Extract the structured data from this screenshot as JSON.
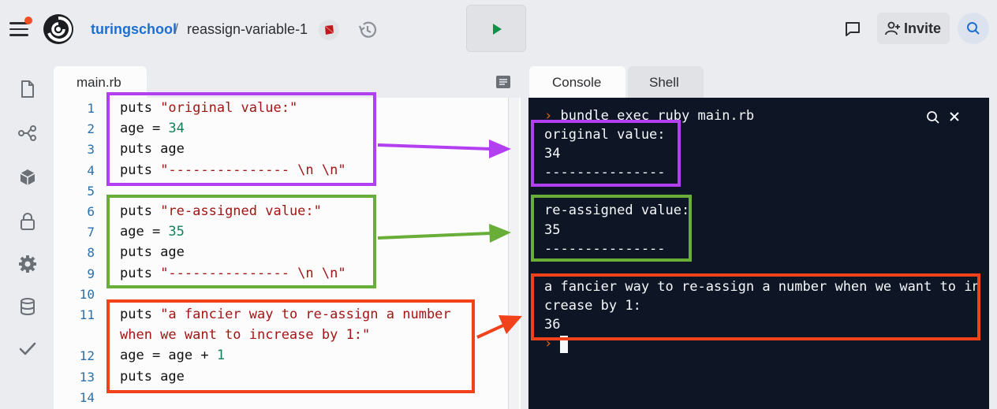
{
  "header": {
    "owner": "turingschool",
    "separator": "/",
    "repl_name": "reassign-variable-1",
    "invite_label": "Invite"
  },
  "editor": {
    "file_tab": "main.rb",
    "lines": [
      {
        "n": "1",
        "tokens": [
          {
            "t": "puts ",
            "c": "plain"
          },
          {
            "t": "\"original value:\"",
            "c": "str"
          }
        ]
      },
      {
        "n": "2",
        "tokens": [
          {
            "t": "age = ",
            "c": "plain"
          },
          {
            "t": "34",
            "c": "num"
          }
        ]
      },
      {
        "n": "3",
        "tokens": [
          {
            "t": "puts age",
            "c": "plain"
          }
        ]
      },
      {
        "n": "4",
        "tokens": [
          {
            "t": "puts ",
            "c": "plain"
          },
          {
            "t": "\"--------------- \\n \\n\"",
            "c": "str"
          }
        ]
      },
      {
        "n": "5",
        "tokens": []
      },
      {
        "n": "6",
        "tokens": [
          {
            "t": "puts ",
            "c": "plain"
          },
          {
            "t": "\"re-assigned value:\"",
            "c": "str"
          }
        ]
      },
      {
        "n": "7",
        "tokens": [
          {
            "t": "age = ",
            "c": "plain"
          },
          {
            "t": "35",
            "c": "num"
          }
        ]
      },
      {
        "n": "8",
        "tokens": [
          {
            "t": "puts age",
            "c": "plain"
          }
        ]
      },
      {
        "n": "9",
        "tokens": [
          {
            "t": "puts ",
            "c": "plain"
          },
          {
            "t": "\"--------------- \\n \\n\"",
            "c": "str"
          }
        ]
      },
      {
        "n": "10",
        "tokens": []
      },
      {
        "n": "11",
        "tokens": [
          {
            "t": "puts ",
            "c": "plain"
          },
          {
            "t": "\"a fancier way to re-assign a number",
            "c": "str"
          }
        ]
      },
      {
        "n": "",
        "tokens": [
          {
            "t": "when we want to increase by 1:\"",
            "c": "str"
          }
        ]
      },
      {
        "n": "12",
        "tokens": [
          {
            "t": "age = age + ",
            "c": "plain"
          },
          {
            "t": "1",
            "c": "num"
          }
        ]
      },
      {
        "n": "13",
        "tokens": [
          {
            "t": "puts age",
            "c": "plain"
          }
        ]
      },
      {
        "n": "14",
        "tokens": []
      }
    ]
  },
  "console": {
    "tabs": [
      "Console",
      "Shell"
    ],
    "command": "bundle exec ruby main.rb",
    "output": [
      "original value:",
      "34",
      "---------------",
      "",
      "re-assigned value:",
      "35",
      "---------------",
      "",
      "a fancier way to re-assign a number when we want to in",
      "crease by 1:",
      "36"
    ],
    "prompt_symbol": "›"
  },
  "colors": {
    "purple_box": "#b23ff0",
    "green_box": "#6aae3a",
    "red_box": "#f2421b",
    "link_blue": "#1d6fd1",
    "console_bg": "#0e1525"
  },
  "icons": {
    "rail": [
      "file-icon",
      "git-icon",
      "packages-icon",
      "lock-icon",
      "settings-icon",
      "database-icon",
      "check-icon"
    ]
  }
}
